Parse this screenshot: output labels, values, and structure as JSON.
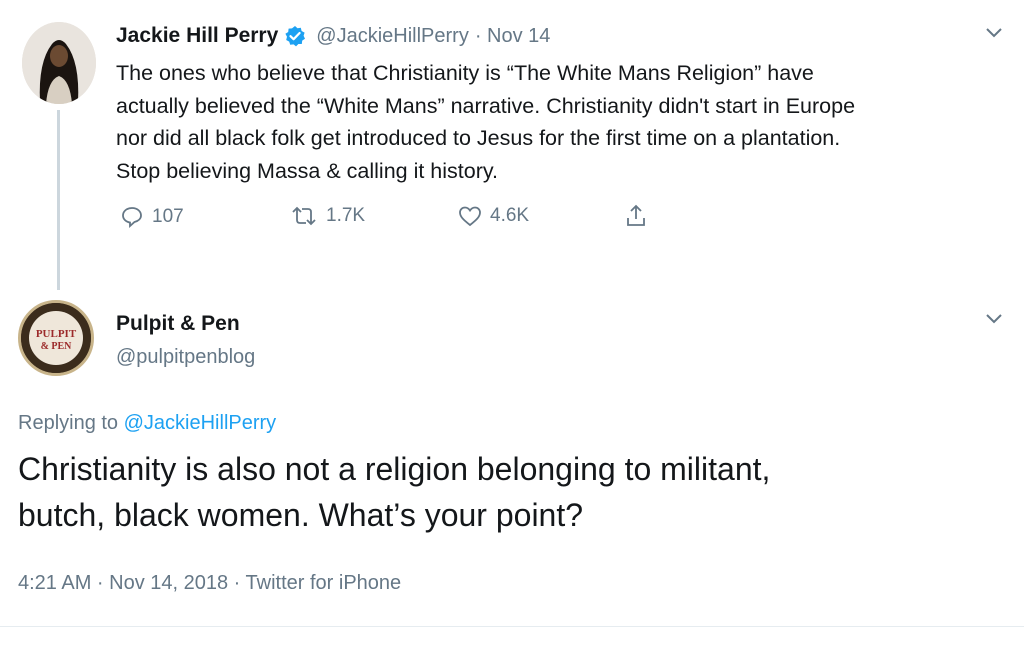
{
  "tweet": {
    "author_name": "Jackie Hill Perry",
    "author_handle": "@JackieHillPerry",
    "date": "· Nov 14",
    "lines": [
      "The ones who believe that Christianity is “The White Mans Religion” have",
      "actually believed the “White Mans” narrative. Christianity didn't start in Europe",
      "nor did all black folk get introduced to Jesus for the first time on a plantation.",
      "Stop believing Massa & calling it history."
    ],
    "actions": {
      "replies": "107",
      "retweets": "1.7K",
      "likes": "4.6K"
    }
  },
  "reply": {
    "author_name": "Pulpit & Pen",
    "author_handle": "@pulpitpenblog",
    "avatar_text_top": "PULPIT",
    "avatar_text_bottom": "& PEN",
    "replying_to_label": "Replying to",
    "replying_to_handle": "@JackieHillPerry",
    "lines": [
      "Christianity is also not a religion belonging to militant,",
      "butch, black women. What’s your point?"
    ],
    "timestamp": "4:21 AM · Nov 14, 2018 · Twitter for iPhone"
  },
  "icons": [
    "verified-badge-icon",
    "reply-icon",
    "retweet-icon",
    "like-icon",
    "share-icon",
    "chevron-down-icon"
  ],
  "colors": {
    "verified": "#1da1f2",
    "link": "#1da1f2",
    "secondary": "#657786",
    "text": "#14171a"
  }
}
